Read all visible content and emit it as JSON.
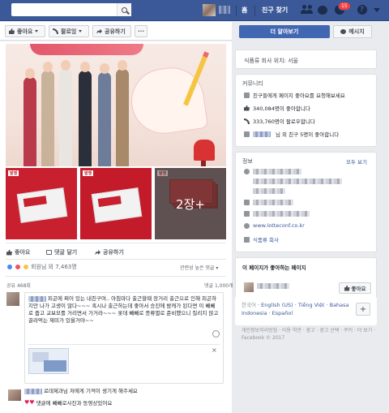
{
  "topbar": {
    "home_label": "홈",
    "find_friends_label": "친구 찾기",
    "notification_count": "15"
  },
  "page_actions": {
    "like_label": "좋아요",
    "follow_label": "팔로잉",
    "share_label": "공유하기",
    "more_label": "···"
  },
  "post": {
    "tile_tag": "발행",
    "tile_overlay_count": "2장+",
    "actions": {
      "like": "좋아요",
      "comment": "댓글 달기",
      "share": "공유하기"
    },
    "reactions_text": "회원님 외 7,463명",
    "sort_label": "관련성 높은 댓글",
    "shares_count": "공유 468회",
    "comment_count": "댓글 1,000개",
    "comment_body": "피곤에 찌어 있는 내친구여.. 아침마다 출근할때 장거리 출근으로 인해 피곤하지만 나가 고생이 많다~~~ 혹시나 출근하는데 좋아서 승진에 밤캐가 된다면 이 빼빼로 줍고 교보모를 거리면서 가거라~~~ 롯데 빼빼로 종류별로 준비했으니 질리지 않고 골라먹는 재미가 있을거야~~",
    "comment_more": "더 보기",
    "attach_close": "×",
    "reply_text": "로데제과님 저에게 기적이 생기게 해주세요",
    "reply2_text": "댓글에 빼빼로사진과 동영상있어요"
  },
  "sidebar": {
    "learn_more": "더 알아보기",
    "message": "메시지",
    "find_company": "식품류 회사 위치: 서울",
    "community_title": "커뮤니티",
    "invite_friends": "친구들에게 페이지 좋아요를 요청해보세요",
    "likes_count": "340,084명이 좋아합니다",
    "followers_count": "333,760명이 팔로우합니다",
    "friends_like": "님 외 친구 5명이 좋아합니다",
    "info_title": "정보",
    "see_all": "모두 보기",
    "website": "www.lotteconf.co.kr",
    "category": "식품류 회사",
    "liked_pages_title": "이 페이지가 좋아하는 페이지",
    "liked_page_button": "좋아요",
    "languages": {
      "current": "한국어",
      "others": [
        "English (US)",
        "Tiếng Việt",
        "Bahasa Indonesia",
        "Español"
      ]
    },
    "lang_add": "+",
    "footer": "개인정보처리방침 · 이용 약관 · 광고 · 광고 선택 · 쿠키 · 더 보기 · Facebook © 2017"
  },
  "colors": {
    "brand": "#3b5998",
    "primary_button": "#4267b2",
    "link": "#385898",
    "badge": "#fa3e3e"
  }
}
